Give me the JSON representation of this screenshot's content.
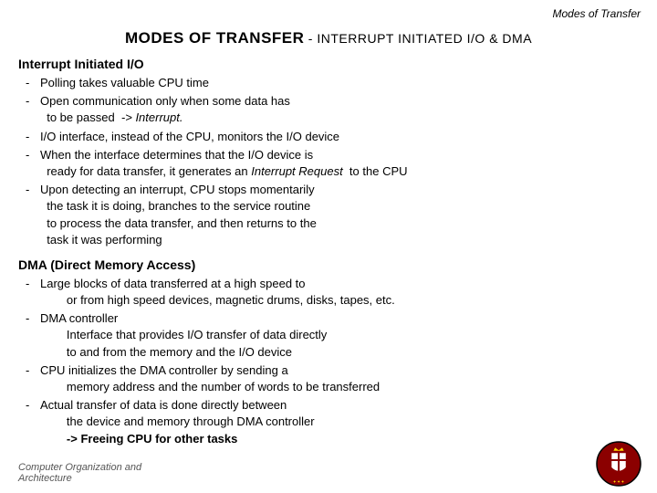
{
  "slide": {
    "top_right_title": "Modes of Transfer",
    "main_title_bold": "MODES  OF  TRANSFER",
    "main_title_normal": " - INTERRUPT  INITIATED  I/O & DMA",
    "interrupt_heading": "Interrupt Initiated I/O",
    "interrupt_bullets": [
      {
        "dash": "-",
        "text": "Polling takes valuable CPU time"
      },
      {
        "dash": "-",
        "text": "Open communication only when some data has\n        to be passed  -> Interrupt."
      },
      {
        "dash": "-",
        "text": "I/O interface, instead of the CPU, monitors the I/O device"
      },
      {
        "dash": "-",
        "text": "When the interface determines that the I/O device is\n        ready for data transfer, it generates an Interrupt Request  to the CPU"
      },
      {
        "dash": "-",
        "text": "Upon detecting an interrupt, CPU stops momentarily\n        the task it is doing, branches to the service routine\n        to process the data transfer, and then returns to the\n        task it was performing"
      }
    ],
    "dma_heading": "DMA (Direct Memory Access)",
    "dma_bullets": [
      {
        "dash": "-",
        "indent": 0,
        "text": "Large blocks of data transferred at a high speed to\n              or from high speed devices, magnetic drums, disks, tapes, etc."
      },
      {
        "dash": "-",
        "indent": 0,
        "text": "DMA controller\n              Interface that provides I/O transfer of data directly\n              to and from the memory and the I/O device"
      },
      {
        "dash": "-",
        "indent": 0,
        "text": "CPU initializes the DMA controller by sending a\n              memory address and the number of words to be transferred"
      },
      {
        "dash": "-",
        "indent": 0,
        "text": "Actual transfer of data is done directly between\n              the device and memory through DMA controller\n              -> Freeing CPU for other tasks"
      }
    ],
    "footer_line1": "Computer Organization and",
    "footer_line2": "Architecture"
  }
}
